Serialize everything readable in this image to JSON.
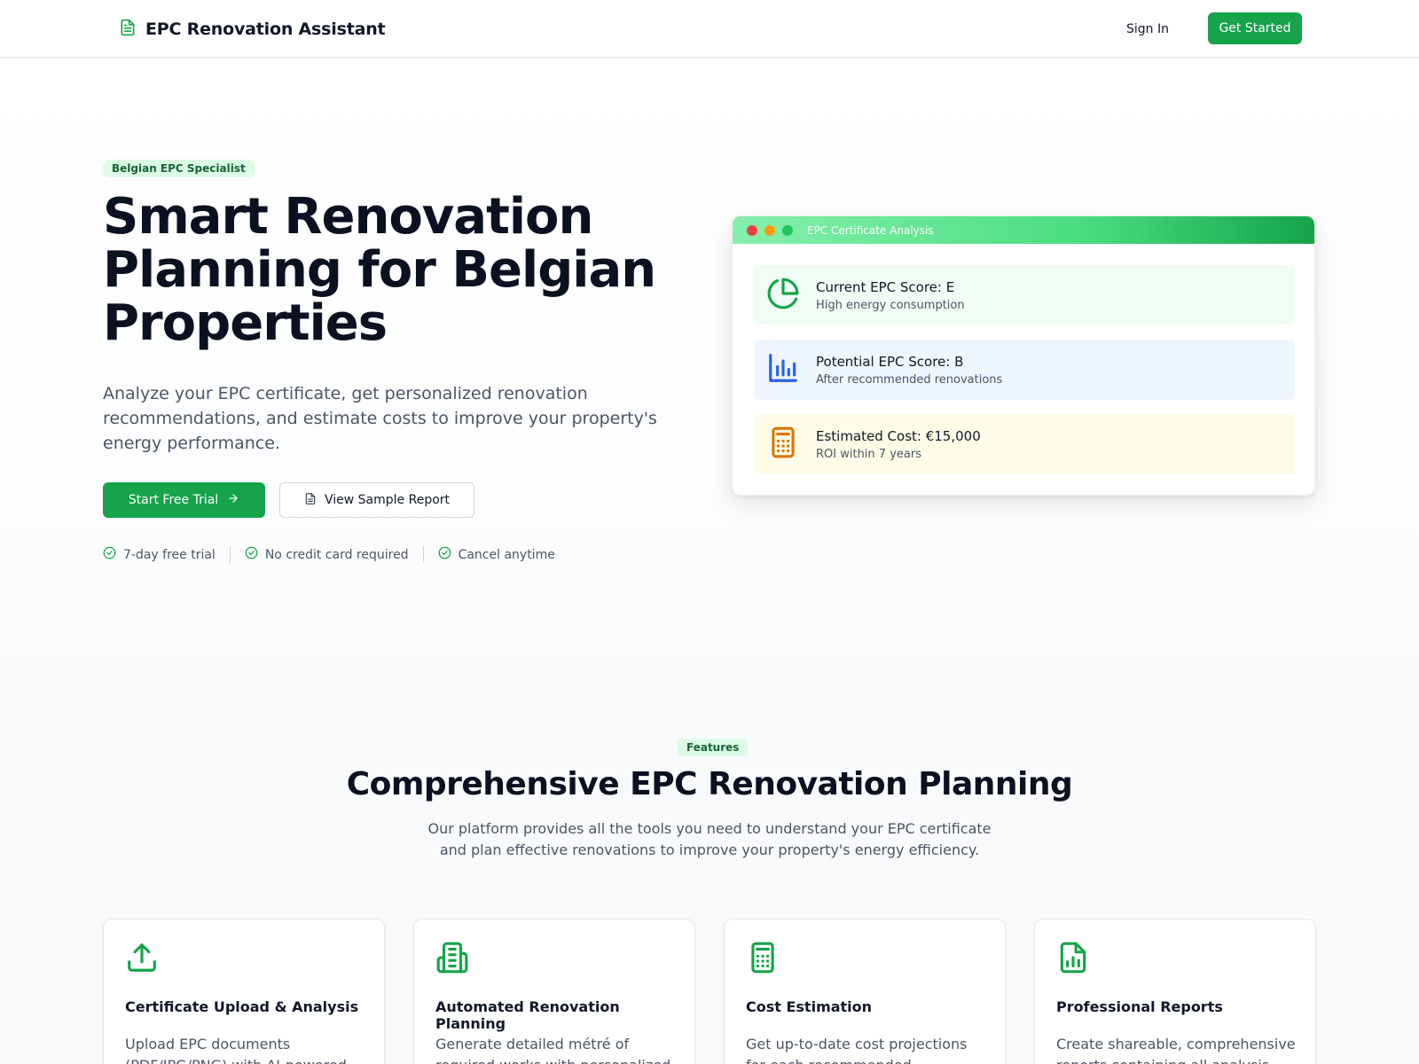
{
  "nav": {
    "brand_title": "EPC Renovation Assistant",
    "brand_icon": "document-icon",
    "sign_in_label": "Sign In",
    "get_started_label": "Get Started"
  },
  "hero": {
    "badge": "Belgian EPC Specialist",
    "title": "Smart Renovation Planning for Belgian Properties",
    "subtitle": "Analyze your EPC certificate, get personalized renovation recommendations, and estimate costs to improve your property's energy performance.",
    "primary_cta": "Start Free Trial",
    "secondary_cta": "View Sample Report",
    "checks": [
      {
        "label": "7-day free trial"
      },
      {
        "label": "No credit card required"
      },
      {
        "label": "Cancel anytime"
      }
    ]
  },
  "epc_card": {
    "title": "EPC Certificate Analysis",
    "window_dots": [
      "#ef4444",
      "#f59e0b",
      "#22c55e"
    ],
    "rows": [
      {
        "icon": "pie-chart-icon",
        "title": "Current EPC Score: E",
        "subtitle": "High energy consumption",
        "bg": "#f0fdf4",
        "color": "#16a34a"
      },
      {
        "icon": "bar-chart-icon",
        "title": "Potential EPC Score: B",
        "subtitle": "After recommended renovations",
        "bg": "#eff6ff",
        "color": "#2563eb"
      },
      {
        "icon": "calculator-icon",
        "title": "Estimated Cost: €15,000",
        "subtitle": "ROI within 7 years",
        "bg": "#fefce8",
        "color": "#d97706"
      }
    ]
  },
  "features": {
    "badge": "Features",
    "title": "Comprehensive EPC Renovation Planning",
    "subtitle": "Our platform provides all the tools you need to understand your EPC certificate and plan effective renovations to improve your property's energy efficiency.",
    "cards": [
      {
        "icon": "upload-icon",
        "title": "Certificate Upload & Analysis",
        "description": "Upload EPC documents (PDF/JPG/PNG) with AI-powered data"
      },
      {
        "icon": "building-icon",
        "title": "Automated Renovation Planning",
        "description": "Generate detailed métré of required works with personalized"
      },
      {
        "icon": "calculator-icon",
        "title": "Cost Estimation",
        "description": "Get up-to-date cost projections for each recommended renovation"
      },
      {
        "icon": "report-icon",
        "title": "Professional Reports",
        "description": "Create shareable, comprehensive reports containing all analysis"
      }
    ]
  },
  "colors": {
    "accent": "#16a34a",
    "badge_bg": "#dcfce7",
    "badge_text": "#166534"
  }
}
